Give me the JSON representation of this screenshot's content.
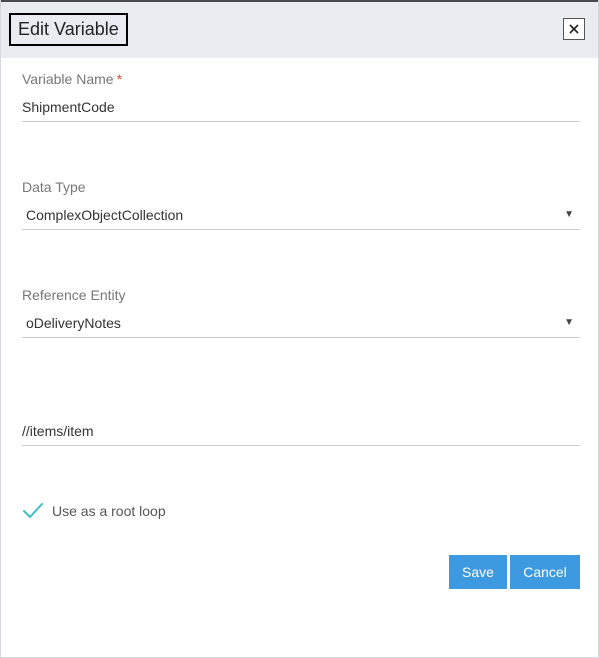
{
  "dialog": {
    "title": "Edit Variable",
    "close_icon": "close-icon"
  },
  "variable_name": {
    "label": "Variable Name",
    "required_mark": "*",
    "value": "ShipmentCode"
  },
  "data_type": {
    "label": "Data Type",
    "value": "ComplexObjectCollection",
    "caret_icon": "caret-down-icon"
  },
  "reference_entity": {
    "label": "Reference Entity",
    "value": "oDeliveryNotes",
    "caret_icon": "caret-down-icon"
  },
  "path": {
    "value": "//items/item"
  },
  "root_loop": {
    "label": "Use as a root loop",
    "checked": true,
    "check_color": "#3cbfc7"
  },
  "actions": {
    "save_label": "Save",
    "cancel_label": "Cancel",
    "button_color": "#3e9ae0"
  }
}
